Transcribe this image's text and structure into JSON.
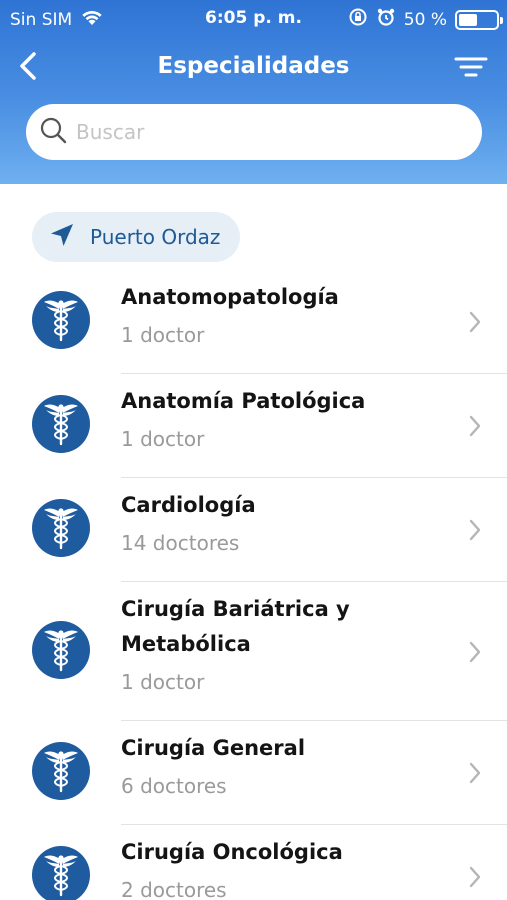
{
  "status_bar": {
    "carrier": "Sin SIM",
    "time": "6:05 p. m.",
    "battery_text": "50 %",
    "battery_level": 0.5,
    "icons": [
      "wifi-icon",
      "orientation-lock-icon",
      "alarm-icon",
      "battery-icon"
    ]
  },
  "nav": {
    "title": "Especialidades",
    "back_icon": "chevron-left-icon",
    "filter_icon": "filter-icon"
  },
  "search": {
    "placeholder": "Buscar",
    "value": ""
  },
  "location": {
    "label": "Puerto Ordaz",
    "icon": "location-arrow-icon"
  },
  "specialties": [
    {
      "name_lines": [
        "Anatomopatología"
      ],
      "count": "1 doctor"
    },
    {
      "name_lines": [
        "Anatomía Patológica"
      ],
      "count": "1 doctor"
    },
    {
      "name_lines": [
        "Cardiología"
      ],
      "count": "14 doctores"
    },
    {
      "name_lines": [
        "Cirugía Bariátrica y",
        "Metabólica"
      ],
      "count": "1 doctor"
    },
    {
      "name_lines": [
        "Cirugía General"
      ],
      "count": "6 doctores"
    },
    {
      "name_lines": [
        "Cirugía Oncológica"
      ],
      "count": "2 doctores"
    }
  ],
  "colors": {
    "header_gradient_top": "#2f74d4",
    "header_gradient_bottom": "#6fb0ef",
    "avatar_bg": "#1f5b9f",
    "chip_bg": "#e6eef6",
    "chip_text": "#1e5a96"
  }
}
